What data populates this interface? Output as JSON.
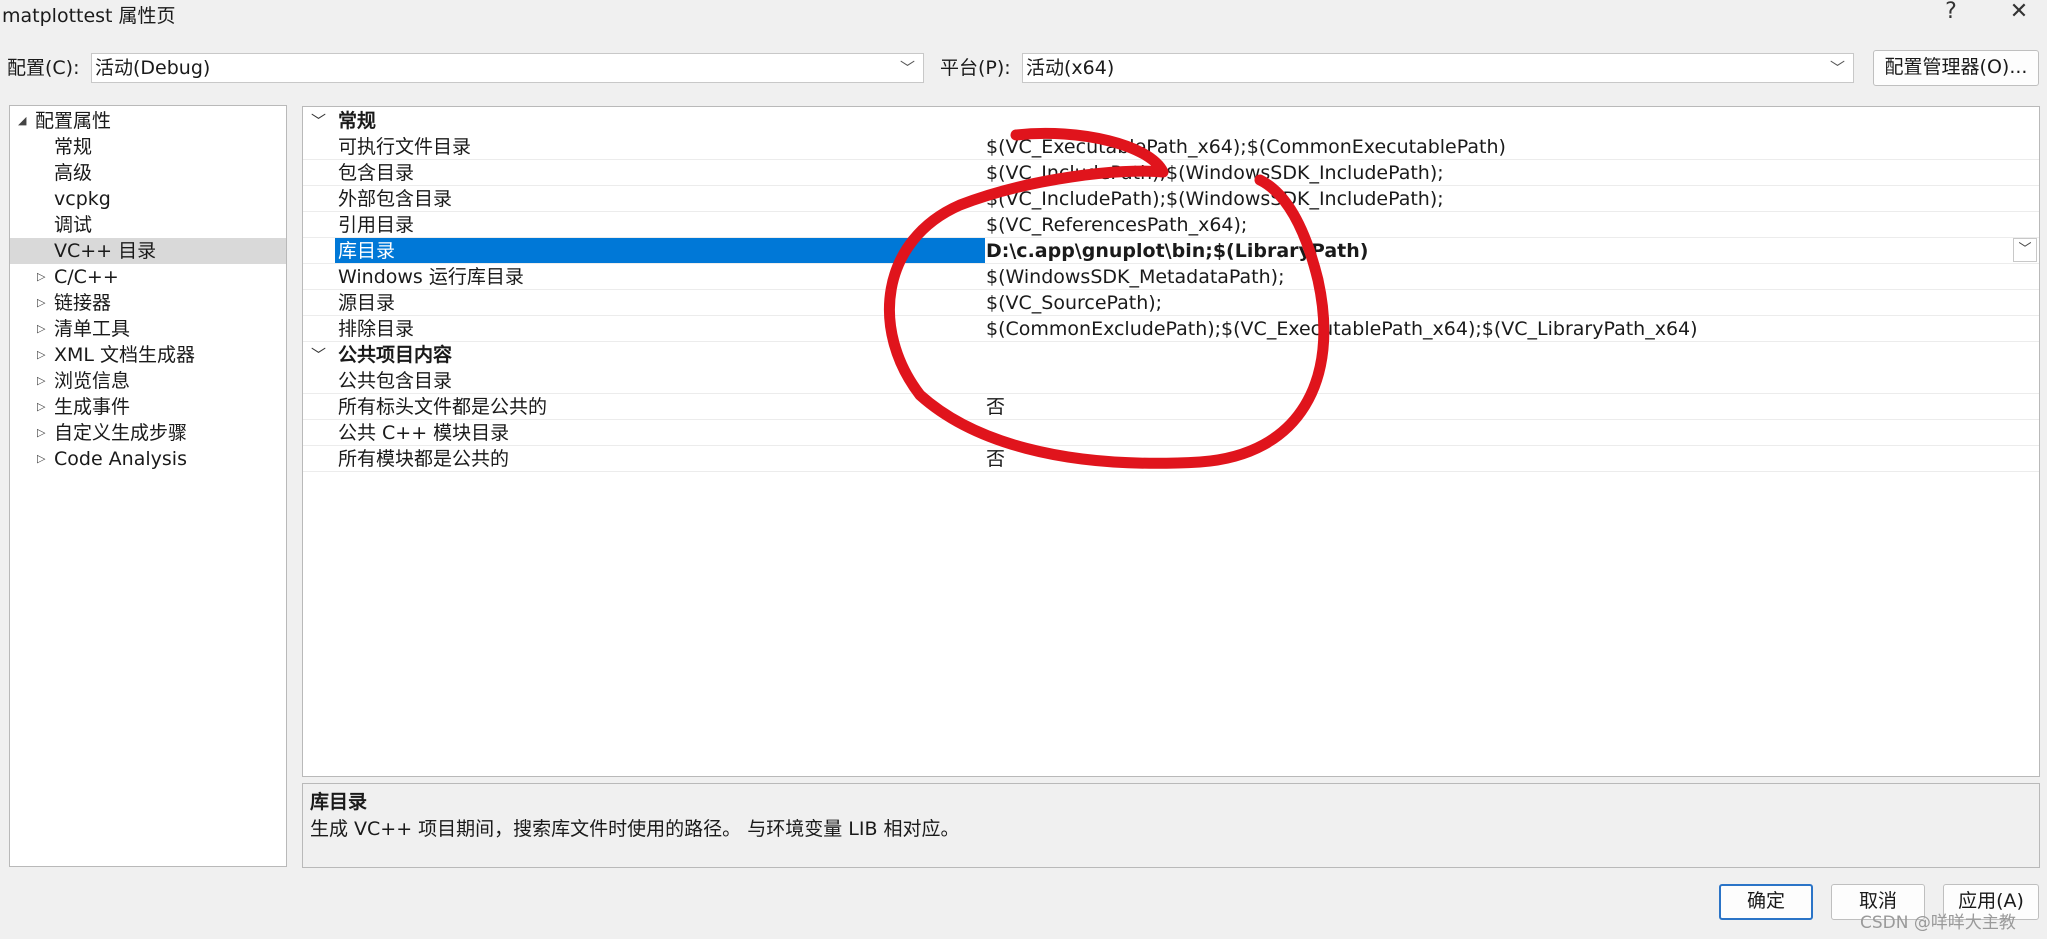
{
  "window": {
    "title": "matplottest 属性页",
    "help_glyph": "?",
    "close_glyph": "✕"
  },
  "toolbar": {
    "config_label": "配置(C):",
    "config_value": "活动(Debug)",
    "platform_label": "平台(P):",
    "platform_value": "活动(x64)",
    "config_manager_label": "配置管理器(O)..."
  },
  "tree": {
    "root": "配置属性",
    "items": [
      {
        "label": "常规",
        "expandable": false
      },
      {
        "label": "高级",
        "expandable": false
      },
      {
        "label": "vcpkg",
        "expandable": false
      },
      {
        "label": "调试",
        "expandable": false
      },
      {
        "label": "VC++ 目录",
        "expandable": false,
        "selected": true
      },
      {
        "label": "C/C++",
        "expandable": true
      },
      {
        "label": "链接器",
        "expandable": true
      },
      {
        "label": "清单工具",
        "expandable": true
      },
      {
        "label": "XML 文档生成器",
        "expandable": true
      },
      {
        "label": "浏览信息",
        "expandable": true
      },
      {
        "label": "生成事件",
        "expandable": true
      },
      {
        "label": "自定义生成步骤",
        "expandable": true
      },
      {
        "label": "Code Analysis",
        "expandable": true
      }
    ]
  },
  "grid": {
    "sections": [
      {
        "title": "常规",
        "rows": [
          {
            "name": "可执行文件目录",
            "value": "$(VC_ExecutablePath_x64);$(CommonExecutablePath)"
          },
          {
            "name": "包含目录",
            "value": "$(VC_IncludePath);$(WindowsSDK_IncludePath);"
          },
          {
            "name": "外部包含目录",
            "value": "$(VC_IncludePath);$(WindowsSDK_IncludePath);"
          },
          {
            "name": "引用目录",
            "value": "$(VC_ReferencesPath_x64);"
          },
          {
            "name": "库目录",
            "value": "D:\\c.app\\gnuplot\\bin;$(LibraryPath)",
            "selected": true
          },
          {
            "name": "Windows 运行库目录",
            "value": "$(WindowsSDK_MetadataPath);"
          },
          {
            "name": "源目录",
            "value": "$(VC_SourcePath);"
          },
          {
            "name": "排除目录",
            "value": "$(CommonExcludePath);$(VC_ExecutablePath_x64);$(VC_LibraryPath_x64)"
          }
        ]
      },
      {
        "title": "公共项目内容",
        "rows": [
          {
            "name": "公共包含目录",
            "value": ""
          },
          {
            "name": "所有标头文件都是公共的",
            "value": "否"
          },
          {
            "name": "公共 C++ 模块目录",
            "value": ""
          },
          {
            "name": "所有模块都是公共的",
            "value": "否"
          }
        ]
      }
    ]
  },
  "description": {
    "title": "库目录",
    "text": "生成 VC++ 项目期间，搜索库文件时使用的路径。 与环境变量 LIB 相对应。"
  },
  "buttons": {
    "ok": "确定",
    "cancel": "取消",
    "apply": "应用(A)"
  },
  "watermark": "CSDN @咩咩大主教",
  "colors": {
    "selection": "#0078d7",
    "annotation": "#e0141c",
    "primary_button_border": "#2b74c7"
  }
}
